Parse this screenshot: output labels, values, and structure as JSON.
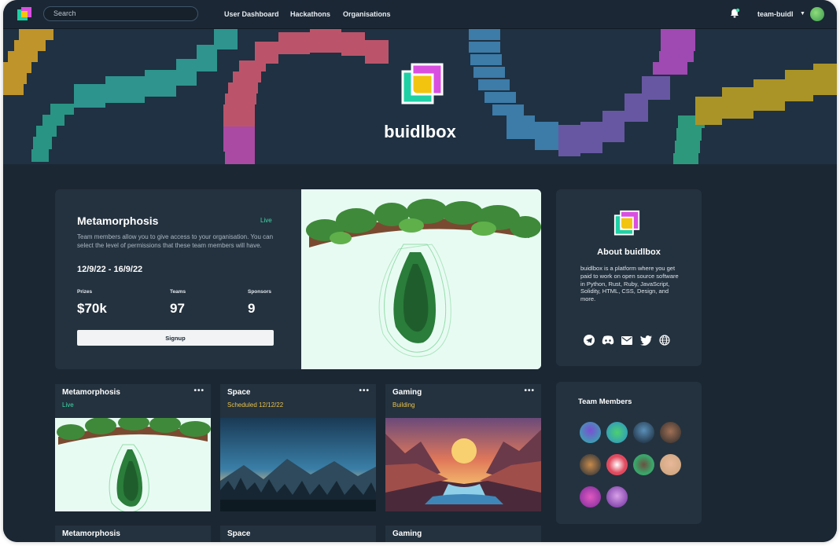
{
  "topbar": {
    "search_placeholder": "Search",
    "nav": [
      "User Dashboard",
      "Hackathons",
      "Organisations"
    ],
    "username": "team-buidl"
  },
  "banner": {
    "title": "buidlbox"
  },
  "hero": {
    "title": "Metamorphosis",
    "status": "Live",
    "description": "Team members allow you to give access to your organisation. You can select the level of permissions that these team members will have.",
    "dates": "12/9/22 - 16/9/22",
    "stats": [
      {
        "label": "Prizes",
        "value": "$70k"
      },
      {
        "label": "Teams",
        "value": "97"
      },
      {
        "label": "Sponsors",
        "value": "9"
      }
    ],
    "signup_label": "Signup"
  },
  "about": {
    "title": "About buidlbox",
    "description": "buidlbox is a platform where you get paid to work on open source software in Python, Rust, Ruby, JavaScript, Solidity, HTML, CSS, Design, and more.",
    "socials": [
      "telegram-icon",
      "discord-icon",
      "mail-icon",
      "twitter-icon",
      "globe-icon"
    ]
  },
  "team": {
    "title": "Team Members",
    "count": 10
  },
  "cards": [
    {
      "title": "Metamorphosis",
      "status": "Live",
      "status_color": "#3ed9a6",
      "more": "•••"
    },
    {
      "title": "Space",
      "status": "Scheduled 12/12/22",
      "status_color": "#e8c14a",
      "more": "•••"
    },
    {
      "title": "Gaming",
      "status": "Building",
      "status_color": "#e8c14a",
      "more": "•••"
    }
  ],
  "cards_row2": [
    {
      "title": "Metamorphosis"
    },
    {
      "title": "Space"
    },
    {
      "title": "Gaming"
    }
  ],
  "colors": {
    "accent_live": "#3ed9a6",
    "accent_building": "#e8c14a",
    "background": "#1b2733",
    "card": "#24323f"
  }
}
